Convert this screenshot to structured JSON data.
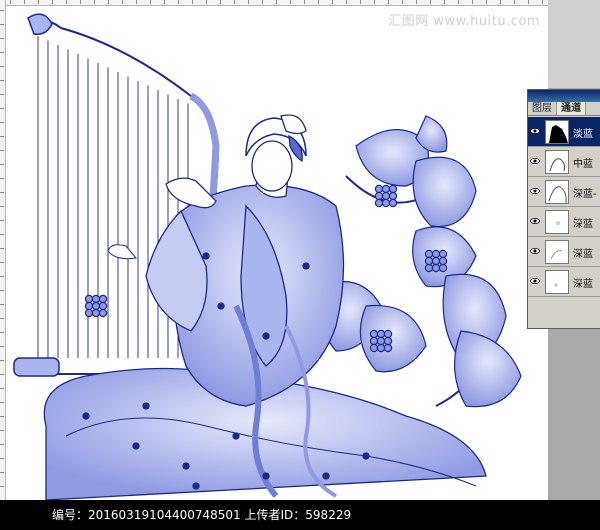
{
  "watermark": {
    "site": "汇图网 www.huitu.com"
  },
  "channels_panel": {
    "tabs": [
      {
        "label": "图层",
        "active": false
      },
      {
        "label": "通道",
        "active": true
      }
    ],
    "channels": [
      {
        "label": "淡蓝",
        "active": true
      },
      {
        "label": "中蓝",
        "active": false
      },
      {
        "label": "深蓝-",
        "active": false
      },
      {
        "label": "深蓝",
        "active": false
      },
      {
        "label": "深蓝",
        "active": false
      },
      {
        "label": "深蓝",
        "active": false
      }
    ]
  },
  "info_bar": {
    "text": "编号：20160319104400748501 上传者ID：598229"
  },
  "colors": {
    "ink": "#1a2a8a",
    "fill": "#aab4ee",
    "light_fill": "#d3d8f7",
    "panel": "#d4d0c8",
    "selection": "#0a246a"
  }
}
